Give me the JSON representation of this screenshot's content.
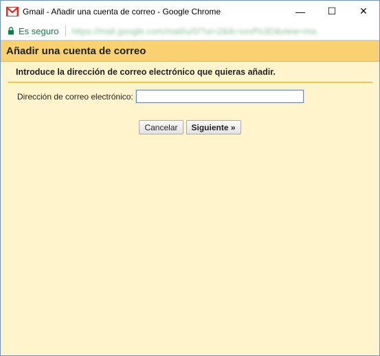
{
  "window": {
    "title": "Gmail - Añadir una cuenta de correo - Google Chrome",
    "minimize_glyph": "—",
    "maximize_glyph": "☐",
    "close_glyph": "✕"
  },
  "addressbar": {
    "secure_label": "Es seguro",
    "url": "https://mail.google.com/mail/u/0/?ui=2&ik=xxxf%3D&view=ma"
  },
  "dialog": {
    "title": "Añadir una cuenta de correo",
    "instruction": "Introduce la dirección de correo electrónico que quieras añadir.",
    "email_label": "Dirección de correo electrónico:",
    "email_value": "",
    "cancel_label": "Cancelar",
    "next_label": "Siguiente »"
  },
  "colors": {
    "header_bg": "#f9d170",
    "content_bg": "#fff4cc",
    "secure_green": "#0b8043",
    "gmail_red": "#d93025"
  },
  "icons": [
    "gmail-icon",
    "lock-icon"
  ]
}
